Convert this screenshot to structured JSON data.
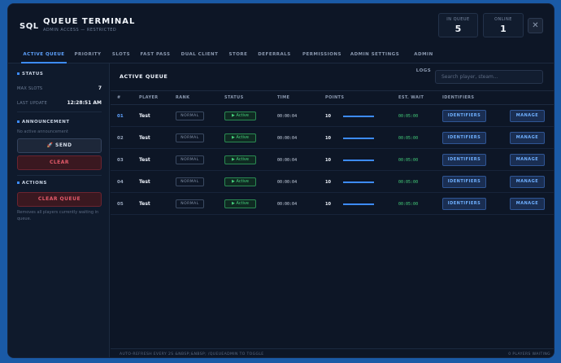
{
  "header": {
    "logo": "SQL",
    "title": "QUEUE TERMINAL",
    "subtitle": "ADMIN ACCESS — RESTRICTED",
    "in_queue_label": "IN QUEUE",
    "in_queue_value": "5",
    "online_label": "ONLINE",
    "online_value": "1",
    "close_label": "✕"
  },
  "tabs": [
    {
      "label": "ACTIVE QUEUE",
      "active": true
    },
    {
      "label": "PRIORITY"
    },
    {
      "label": "SLOTS"
    },
    {
      "label": "FAST PASS"
    },
    {
      "label": "DUAL CLIENT"
    },
    {
      "label": "STORE"
    },
    {
      "label": "DEFERRALS"
    },
    {
      "label": "PERMISSIONS"
    },
    {
      "label": "ADMIN SETTINGS"
    },
    {
      "label": "ADMIN LOGS"
    }
  ],
  "sidebar": {
    "status_title": "STATUS",
    "max_slots_label": "MAX SLOTS",
    "max_slots_value": "7",
    "last_update_label": "LAST UPDATE",
    "last_update_value": "12:28:51 AM",
    "announcement_title": "ANNOUNCEMENT",
    "announcement_text": "No active announcement",
    "send_label": "🚀 SEND",
    "clear_label": "CLEAR",
    "actions_title": "ACTIONS",
    "clear_queue_label": "CLEAR QUEUE",
    "clear_queue_desc": "Removes all players currently waiting in queue."
  },
  "main": {
    "title": "ACTIVE QUEUE",
    "search_placeholder": "Search player, steam...",
    "columns": [
      "#",
      "PLAYER",
      "RANK",
      "STATUS",
      "TIME",
      "POINTS",
      "EST. WAIT",
      "IDENTIFIERS"
    ],
    "rows": [
      {
        "num": "01",
        "player": "Test",
        "rank": "NORMAL",
        "status": "▶ Active",
        "time": "00:00:04",
        "points": "10",
        "progress": 1.0,
        "wait": "00:05:00",
        "identifiers": "IDENTIFIERS",
        "manage": "MANAGE"
      },
      {
        "num": "02",
        "player": "Test",
        "rank": "NORMAL",
        "status": "▶ Active",
        "time": "00:00:04",
        "points": "10",
        "progress": 1.0,
        "wait": "00:05:00",
        "identifiers": "IDENTIFIERS",
        "manage": "MANAGE"
      },
      {
        "num": "03",
        "player": "Test",
        "rank": "NORMAL",
        "status": "▶ Active",
        "time": "00:00:04",
        "points": "10",
        "progress": 1.0,
        "wait": "00:05:00",
        "identifiers": "IDENTIFIERS",
        "manage": "MANAGE"
      },
      {
        "num": "04",
        "player": "Test",
        "rank": "NORMAL",
        "status": "▶ Active",
        "time": "00:00:04",
        "points": "10",
        "progress": 1.0,
        "wait": "00:05:00",
        "identifiers": "IDENTIFIERS",
        "manage": "MANAGE"
      },
      {
        "num": "05",
        "player": "Test",
        "rank": "NORMAL",
        "status": "▶ Active",
        "time": "00:00:04",
        "points": "10",
        "progress": 1.0,
        "wait": "00:05:00",
        "identifiers": "IDENTIFIERS",
        "manage": "MANAGE"
      }
    ],
    "footer_left": "AUTO-REFRESH EVERY 2S &NBSP;&NBSP; /QUEUEADMIN TO TOGGLE",
    "footer_right": "0 PLAYERS WAITING"
  },
  "colors": {
    "accent": "#3d8cff",
    "active_green": "#45d07c",
    "danger": "#e35a6a",
    "background": "#0d1626"
  }
}
